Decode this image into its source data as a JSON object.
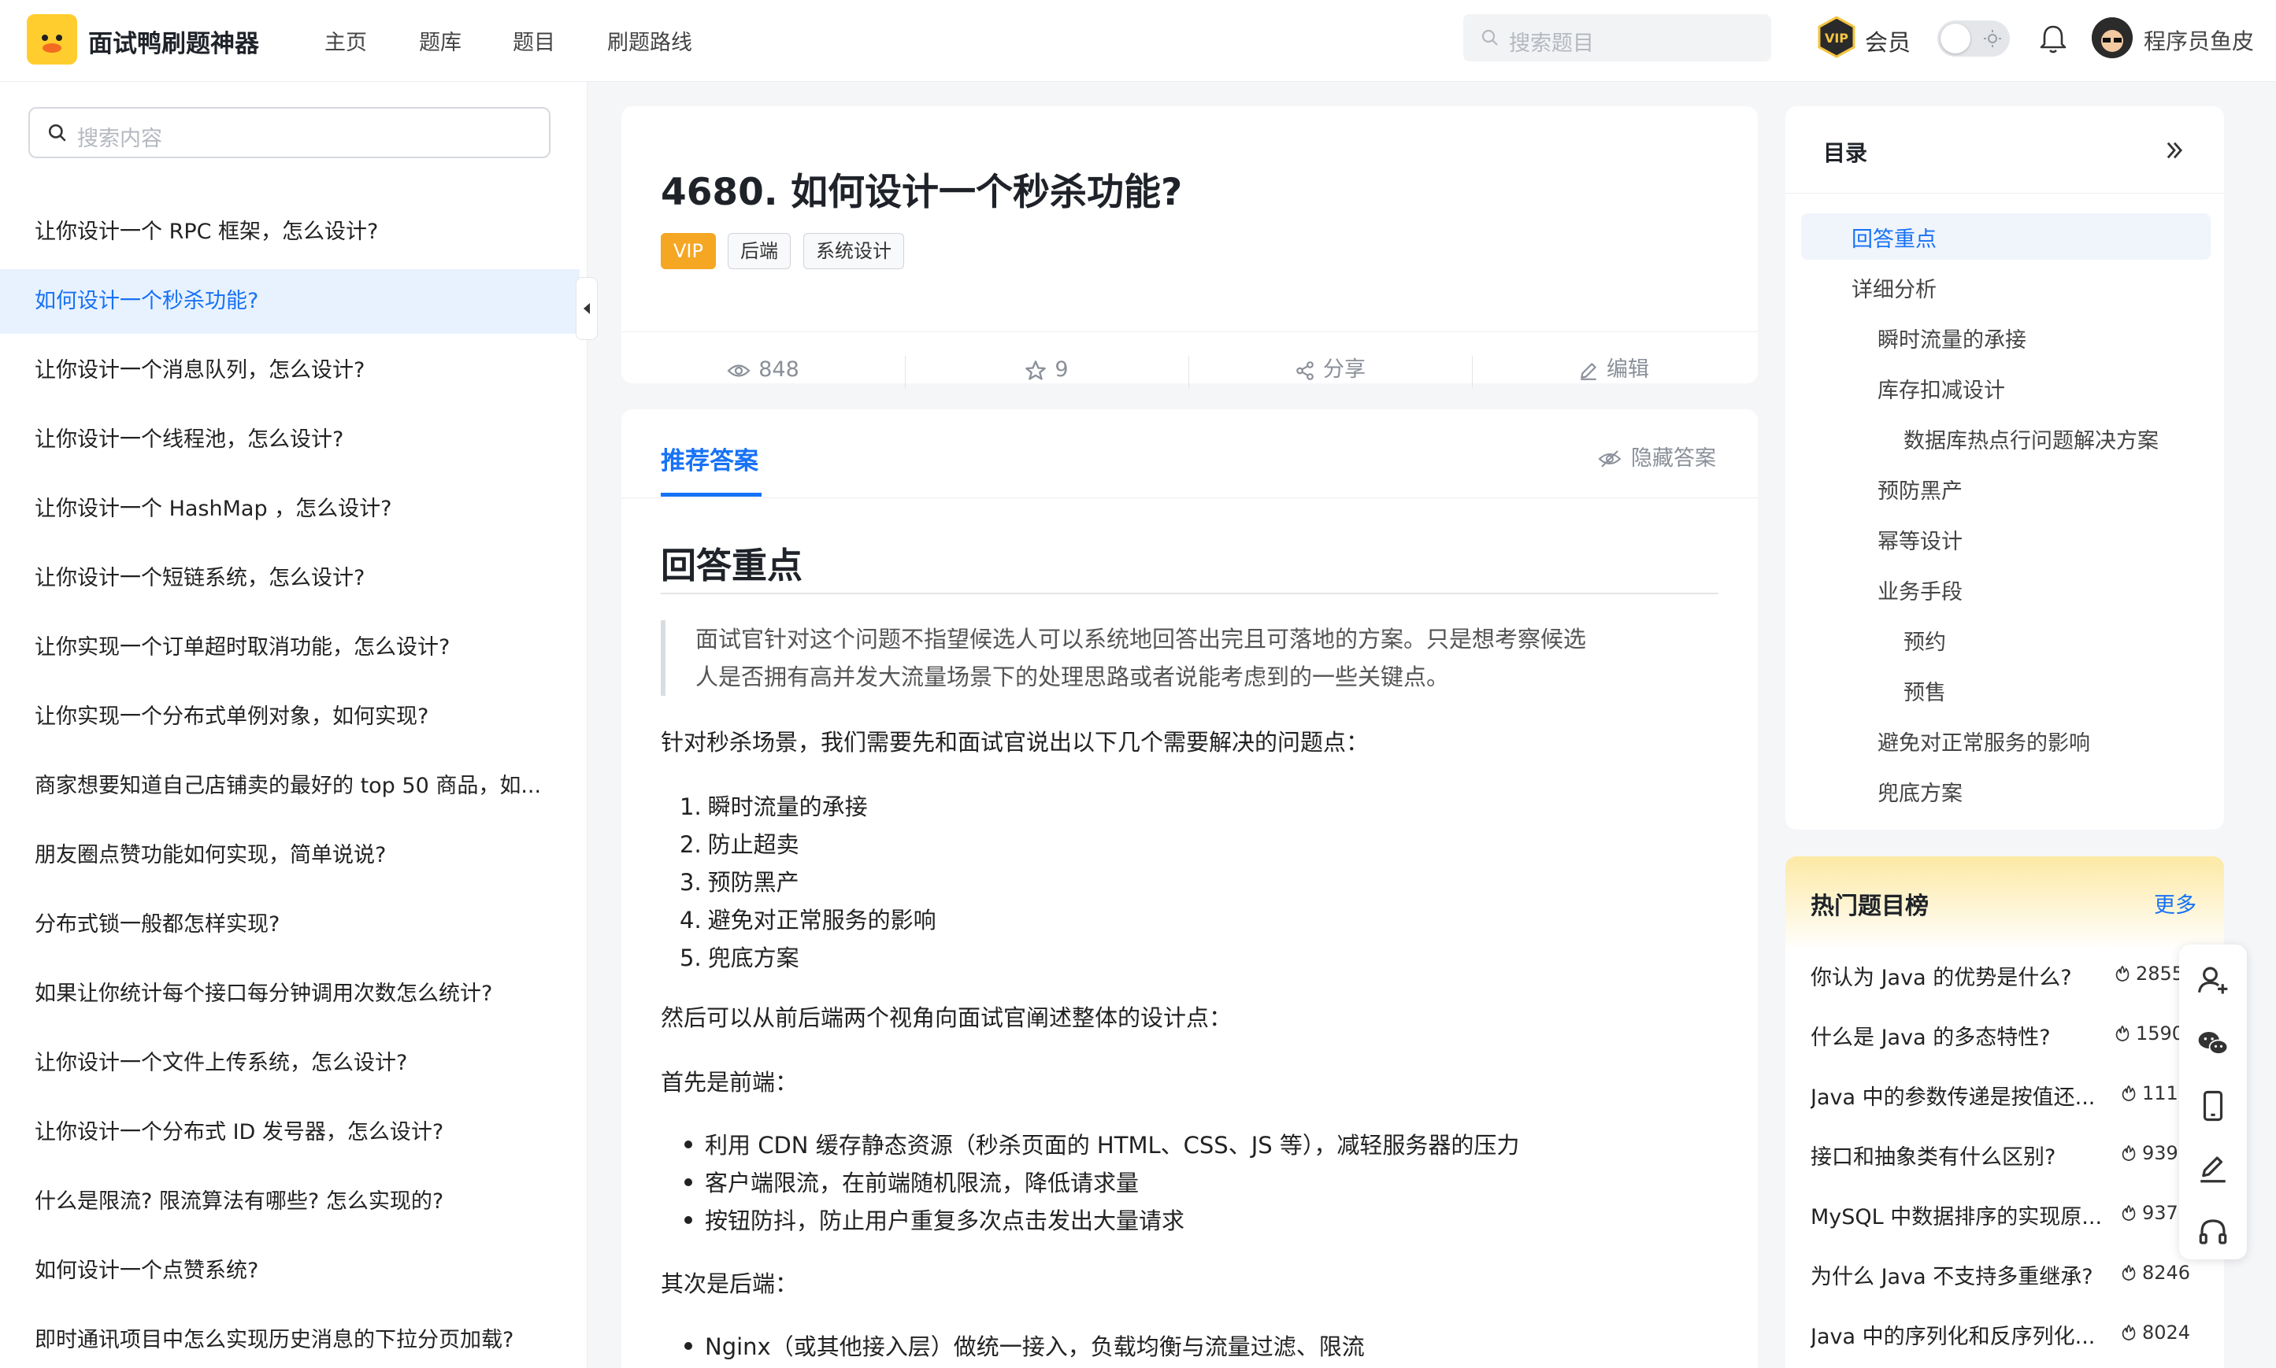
{
  "header": {
    "brand": "面试鸭刷题神器",
    "nav": [
      "主页",
      "题库",
      "题目",
      "刷题路线"
    ],
    "search_placeholder": "搜索题目",
    "vip_label": "会员",
    "username": "程序员鱼皮"
  },
  "sidebar": {
    "search_placeholder": "搜索内容",
    "active_index": 1,
    "items": [
      "让你设计一个 RPC 框架，怎么设计?",
      "如何设计一个秒杀功能?",
      "让你设计一个消息队列，怎么设计?",
      "让你设计一个线程池，怎么设计?",
      "让你设计一个 HashMap ，怎么设计?",
      "让你设计一个短链系统，怎么设计?",
      "让你实现一个订单超时取消功能，怎么设计?",
      "让你实现一个分布式单例对象，如何实现?",
      "商家想要知道自己店铺卖的最好的 top 50 商品，如...",
      "朋友圈点赞功能如何实现，简单说说?",
      "分布式锁一般都怎样实现?",
      "如果让你统计每个接口每分钟调用次数怎么统计?",
      "让你设计一个文件上传系统，怎么设计?",
      "让你设计一个分布式 ID 发号器，怎么设计?",
      "什么是限流? 限流算法有哪些? 怎么实现的?",
      "如何设计一个点赞系统?",
      "即时通讯项目中怎么实现历史消息的下拉分页加载?"
    ]
  },
  "question": {
    "title": "4680. 如何设计一个秒杀功能?",
    "tags": [
      "VIP",
      "后端",
      "系统设计"
    ],
    "views": "848",
    "stars": "9",
    "share_label": "分享",
    "edit_label": "编辑"
  },
  "answer": {
    "tab_label": "推荐答案",
    "hide_label": "隐藏答案",
    "heading": "回答重点",
    "quote_line1": "面试官针对这个问题不指望候选人可以系统地回答出完且可落地的方案。只是想考察候选",
    "quote_line2": "人是否拥有高并发大流量场景下的处理思路或者说能考虑到的一些关键点。",
    "intro": "针对秒杀场景，我们需要先和面试官说出以下几个需要解决的问题点：",
    "problems": [
      "瞬时流量的承接",
      "防止超卖",
      "预防黑产",
      "避免对正常服务的影响",
      "兜底方案"
    ],
    "design_intro": "然后可以从前后端两个视角向面试官阐述整体的设计点：",
    "frontend_label": "首先是前端：",
    "frontend_points": [
      "利用 CDN 缓存静态资源（秒杀页面的 HTML、CSS、JS 等），减轻服务器的压力",
      "客户端限流，在前端随机限流，降低请求量",
      "按钮防抖，防止用户重复多次点击发出大量请求"
    ],
    "backend_label": "其次是后端：",
    "backend_points": [
      "Nginx（或其他接入层）做统一接入，负载均衡与流量过滤、限流"
    ]
  },
  "toc": {
    "title": "目录",
    "items": [
      {
        "label": "回答重点",
        "level": 0
      },
      {
        "label": "详细分析",
        "level": 0
      },
      {
        "label": "瞬时流量的承接",
        "level": 1
      },
      {
        "label": "库存扣减设计",
        "level": 1
      },
      {
        "label": "数据库热点行问题解决方案",
        "level": 2
      },
      {
        "label": "预防黑产",
        "level": 1
      },
      {
        "label": "幂等设计",
        "level": 1
      },
      {
        "label": "业务手段",
        "level": 1
      },
      {
        "label": "预约",
        "level": 2
      },
      {
        "label": "预售",
        "level": 2
      },
      {
        "label": "避免对正常服务的影响",
        "level": 1
      },
      {
        "label": "兜底方案",
        "level": 1
      }
    ]
  },
  "hot": {
    "title": "热门题目榜",
    "more_label": "更多",
    "items": [
      {
        "q": "你认为 Java 的优势是什么?",
        "count": "2855"
      },
      {
        "q": "什么是 Java 的多态特性?",
        "count": "1590"
      },
      {
        "q": "Java 中的参数传递是按值还...",
        "count": "1110"
      },
      {
        "q": "接口和抽象类有什么区别?",
        "count": "939"
      },
      {
        "q": "MySQL 中数据排序的实现原...",
        "count": "937"
      },
      {
        "q": "为什么 Java 不支持多重继承?",
        "count": "8246"
      },
      {
        "q": "Java 中的序列化和反序列化...",
        "count": "8024"
      }
    ]
  },
  "colors": {
    "accent": "#1772f6",
    "vip": "#f5a623",
    "logo_bg": "#ffcd2e"
  }
}
